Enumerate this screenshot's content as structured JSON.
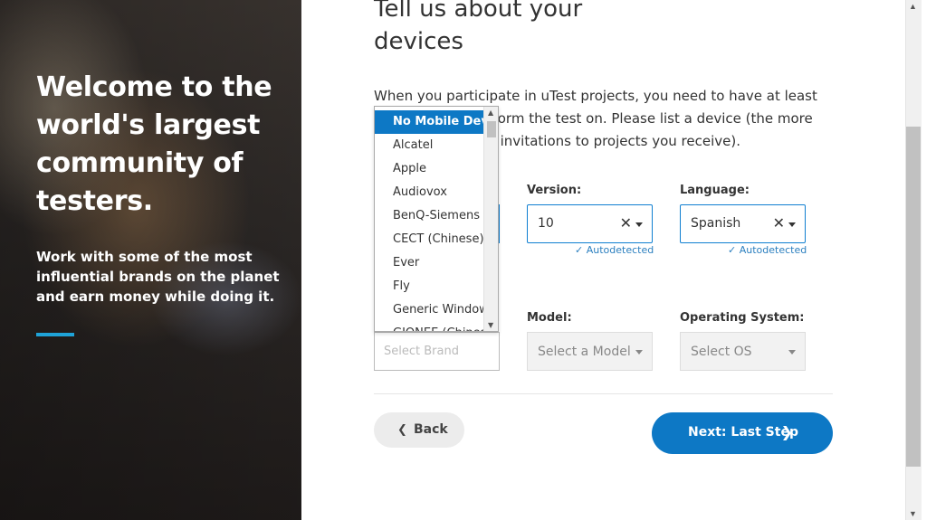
{
  "hero": {
    "title": "Welcome to the world's largest community of testers.",
    "subtitle": "Work with some of the most influential brands on the planet and earn money while doing it.",
    "accent_color": "#1fa3d8"
  },
  "form": {
    "heading": "Tell us about your devices",
    "intro": "When you participate in uTest projects, you need to have at least one device to perform the test on. Please list a device (the more devices, the more invitations to projects you receive).",
    "version": {
      "label": "Version:",
      "value": "10",
      "autodetected": "Autodetected"
    },
    "language": {
      "label": "Language:",
      "value": "Spanish",
      "autodetected": "Autodetected"
    },
    "brand": {
      "placeholder": "Select Brand"
    },
    "model": {
      "label": "Model:",
      "placeholder": "Select a Model"
    },
    "os": {
      "label": "Operating System:",
      "placeholder": "Select OS"
    },
    "back_label": "Back",
    "next_label": "Next: Last Step",
    "primary_color": "#0d78c5"
  },
  "dropdown": {
    "items": [
      "No Mobile Device",
      "Alcatel",
      "Apple",
      "Audiovox",
      "BenQ-Siemens",
      "CECT (Chinese)",
      "Ever",
      "Fly",
      "Generic Windows",
      "GIONEE (Chinese)"
    ],
    "selected_index": 0
  }
}
